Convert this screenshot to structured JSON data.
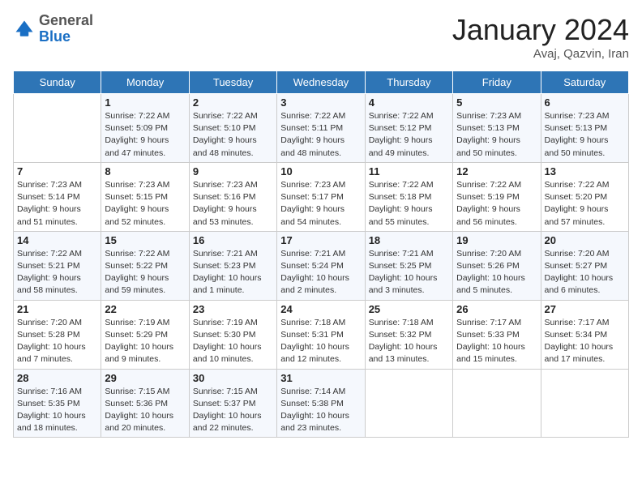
{
  "header": {
    "logo_general": "General",
    "logo_blue": "Blue",
    "title": "January 2024",
    "subtitle": "Avaj, Qazvin, Iran"
  },
  "days_of_week": [
    "Sunday",
    "Monday",
    "Tuesday",
    "Wednesday",
    "Thursday",
    "Friday",
    "Saturday"
  ],
  "weeks": [
    [
      {
        "num": "",
        "info": ""
      },
      {
        "num": "1",
        "info": "Sunrise: 7:22 AM\nSunset: 5:09 PM\nDaylight: 9 hours\nand 47 minutes."
      },
      {
        "num": "2",
        "info": "Sunrise: 7:22 AM\nSunset: 5:10 PM\nDaylight: 9 hours\nand 48 minutes."
      },
      {
        "num": "3",
        "info": "Sunrise: 7:22 AM\nSunset: 5:11 PM\nDaylight: 9 hours\nand 48 minutes."
      },
      {
        "num": "4",
        "info": "Sunrise: 7:22 AM\nSunset: 5:12 PM\nDaylight: 9 hours\nand 49 minutes."
      },
      {
        "num": "5",
        "info": "Sunrise: 7:23 AM\nSunset: 5:13 PM\nDaylight: 9 hours\nand 50 minutes."
      },
      {
        "num": "6",
        "info": "Sunrise: 7:23 AM\nSunset: 5:13 PM\nDaylight: 9 hours\nand 50 minutes."
      }
    ],
    [
      {
        "num": "7",
        "info": "Sunrise: 7:23 AM\nSunset: 5:14 PM\nDaylight: 9 hours\nand 51 minutes."
      },
      {
        "num": "8",
        "info": "Sunrise: 7:23 AM\nSunset: 5:15 PM\nDaylight: 9 hours\nand 52 minutes."
      },
      {
        "num": "9",
        "info": "Sunrise: 7:23 AM\nSunset: 5:16 PM\nDaylight: 9 hours\nand 53 minutes."
      },
      {
        "num": "10",
        "info": "Sunrise: 7:23 AM\nSunset: 5:17 PM\nDaylight: 9 hours\nand 54 minutes."
      },
      {
        "num": "11",
        "info": "Sunrise: 7:22 AM\nSunset: 5:18 PM\nDaylight: 9 hours\nand 55 minutes."
      },
      {
        "num": "12",
        "info": "Sunrise: 7:22 AM\nSunset: 5:19 PM\nDaylight: 9 hours\nand 56 minutes."
      },
      {
        "num": "13",
        "info": "Sunrise: 7:22 AM\nSunset: 5:20 PM\nDaylight: 9 hours\nand 57 minutes."
      }
    ],
    [
      {
        "num": "14",
        "info": "Sunrise: 7:22 AM\nSunset: 5:21 PM\nDaylight: 9 hours\nand 58 minutes."
      },
      {
        "num": "15",
        "info": "Sunrise: 7:22 AM\nSunset: 5:22 PM\nDaylight: 9 hours\nand 59 minutes."
      },
      {
        "num": "16",
        "info": "Sunrise: 7:21 AM\nSunset: 5:23 PM\nDaylight: 10 hours\nand 1 minute."
      },
      {
        "num": "17",
        "info": "Sunrise: 7:21 AM\nSunset: 5:24 PM\nDaylight: 10 hours\nand 2 minutes."
      },
      {
        "num": "18",
        "info": "Sunrise: 7:21 AM\nSunset: 5:25 PM\nDaylight: 10 hours\nand 3 minutes."
      },
      {
        "num": "19",
        "info": "Sunrise: 7:20 AM\nSunset: 5:26 PM\nDaylight: 10 hours\nand 5 minutes."
      },
      {
        "num": "20",
        "info": "Sunrise: 7:20 AM\nSunset: 5:27 PM\nDaylight: 10 hours\nand 6 minutes."
      }
    ],
    [
      {
        "num": "21",
        "info": "Sunrise: 7:20 AM\nSunset: 5:28 PM\nDaylight: 10 hours\nand 7 minutes."
      },
      {
        "num": "22",
        "info": "Sunrise: 7:19 AM\nSunset: 5:29 PM\nDaylight: 10 hours\nand 9 minutes."
      },
      {
        "num": "23",
        "info": "Sunrise: 7:19 AM\nSunset: 5:30 PM\nDaylight: 10 hours\nand 10 minutes."
      },
      {
        "num": "24",
        "info": "Sunrise: 7:18 AM\nSunset: 5:31 PM\nDaylight: 10 hours\nand 12 minutes."
      },
      {
        "num": "25",
        "info": "Sunrise: 7:18 AM\nSunset: 5:32 PM\nDaylight: 10 hours\nand 13 minutes."
      },
      {
        "num": "26",
        "info": "Sunrise: 7:17 AM\nSunset: 5:33 PM\nDaylight: 10 hours\nand 15 minutes."
      },
      {
        "num": "27",
        "info": "Sunrise: 7:17 AM\nSunset: 5:34 PM\nDaylight: 10 hours\nand 17 minutes."
      }
    ],
    [
      {
        "num": "28",
        "info": "Sunrise: 7:16 AM\nSunset: 5:35 PM\nDaylight: 10 hours\nand 18 minutes."
      },
      {
        "num": "29",
        "info": "Sunrise: 7:15 AM\nSunset: 5:36 PM\nDaylight: 10 hours\nand 20 minutes."
      },
      {
        "num": "30",
        "info": "Sunrise: 7:15 AM\nSunset: 5:37 PM\nDaylight: 10 hours\nand 22 minutes."
      },
      {
        "num": "31",
        "info": "Sunrise: 7:14 AM\nSunset: 5:38 PM\nDaylight: 10 hours\nand 23 minutes."
      },
      {
        "num": "",
        "info": ""
      },
      {
        "num": "",
        "info": ""
      },
      {
        "num": "",
        "info": ""
      }
    ]
  ]
}
